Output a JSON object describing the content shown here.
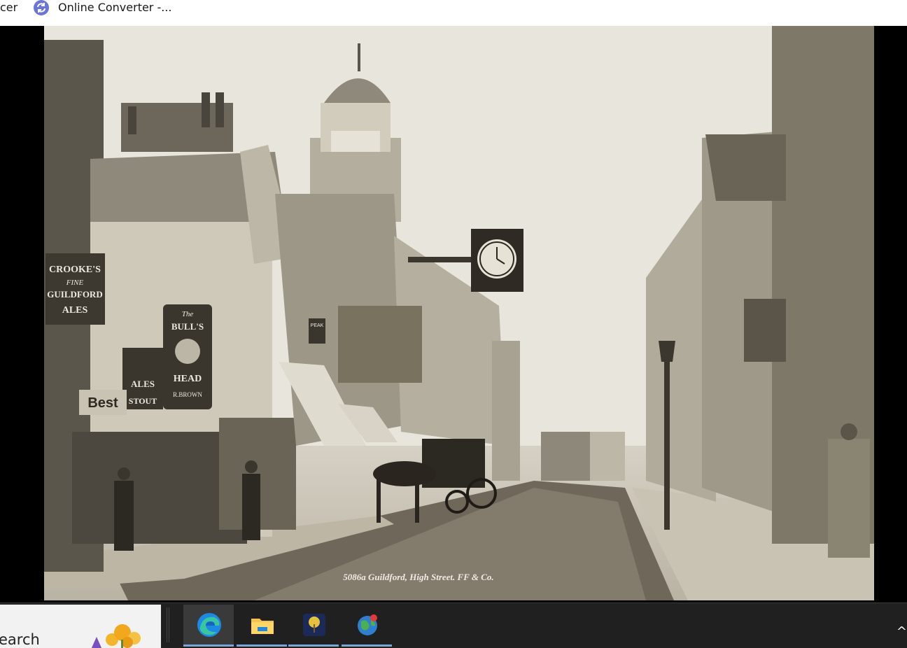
{
  "tabs": {
    "partial_tab_label": "cer",
    "online_converter_label": "Online Converter -..."
  },
  "photo": {
    "signs": {
      "crookes_line1": "CROOKE'S",
      "crookes_line2": "FINE",
      "crookes_line3": "GUILDFORD",
      "crookes_line4": "ALES",
      "bulls_head_line1": "The",
      "bulls_head_line2": "BULL'S",
      "bulls_head_line3": "HEAD",
      "bulls_head_line4": "R.BROWN",
      "ales_line1": "ALES",
      "ales_line2": "STOUT",
      "best": "Best",
      "peak": "PEAK"
    },
    "caption": "5086a Guildford, High Street. FF & Co."
  },
  "taskbar": {
    "search_text": "earch",
    "tray_chevron": "^"
  },
  "colors": {
    "accent_underline": "#7aa6d8",
    "taskbar_bg": "#202020"
  }
}
